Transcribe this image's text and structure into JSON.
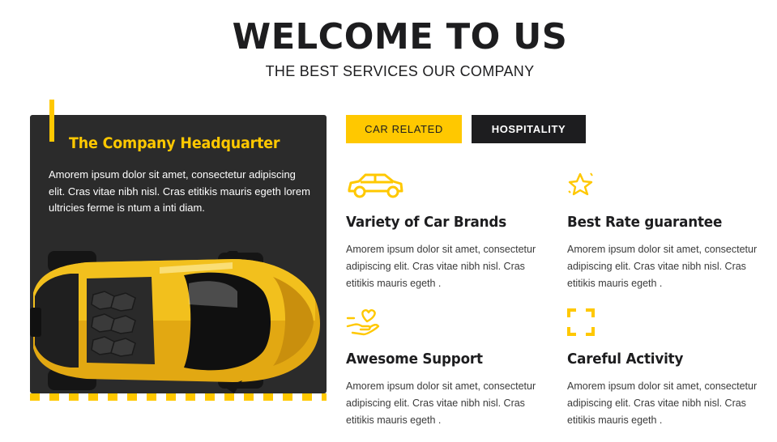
{
  "hero": {
    "title": "WELCOME TO US",
    "subtitle": "THE BEST SERVICES OUR COMPANY"
  },
  "headquarter": {
    "title": "The Company Headquarter",
    "text": "Amorem ipsum dolor sit amet, consectetur adipiscing elit. Cras vitae nibh nisl. Cras etitikis mauris egeth lorem ultricies ferme is ntum a inti diam."
  },
  "tabs": [
    {
      "label": "CAR RELATED",
      "active": true
    },
    {
      "label": "HOSPITALITY",
      "active": false
    }
  ],
  "features": [
    {
      "icon": "car-icon",
      "title": "Variety of Car Brands",
      "text": "Amorem ipsum dolor sit amet, consectetur adipiscing elit. Cras vitae nibh nisl. Cras etitikis mauris egeth ."
    },
    {
      "icon": "star-icon",
      "title": "Best Rate guarantee",
      "text": "Amorem ipsum dolor sit amet, consectetur adipiscing elit. Cras vitae nibh nisl. Cras etitikis mauris egeth ."
    },
    {
      "icon": "hand-heart-icon",
      "title": "Awesome Support",
      "text": "Amorem ipsum dolor sit amet, consectetur adipiscing elit. Cras vitae nibh nisl. Cras etitikis mauris egeth ."
    },
    {
      "icon": "focus-frame-icon",
      "title": "Careful Activity",
      "text": "Amorem ipsum dolor sit amet, consectetur adipiscing elit. Cras vitae nibh nisl. Cras etitikis mauris egeth ."
    }
  ],
  "colors": {
    "accent": "#ffc800",
    "dark": "#1d1d1f",
    "card": "#2b2b2b"
  }
}
